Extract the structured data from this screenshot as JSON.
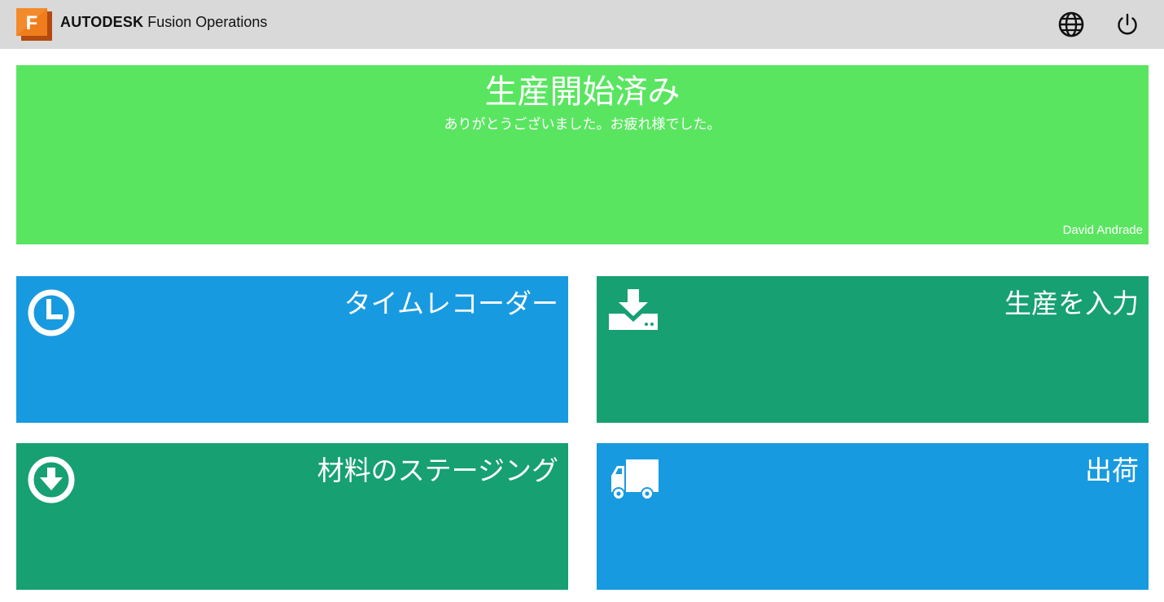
{
  "header": {
    "brand_bold": "AUTODESK",
    "brand_product": "Fusion Operations",
    "logo_letter": "F",
    "logo_color": "#f07d1c",
    "language_icon": "globe-icon",
    "logout_icon": "power-icon"
  },
  "status": {
    "title": "生産開始済み",
    "message": "ありがとうございました。お疲れ様でした。",
    "user": "David Andrade",
    "color": "#5ae561"
  },
  "tiles": [
    {
      "label": "タイムレコーダー",
      "icon": "clock-icon",
      "color": "#189ae0"
    },
    {
      "label": "生産を入力",
      "icon": "download-tray-icon",
      "color": "#17a071"
    },
    {
      "label": "材料のステージング",
      "icon": "download-circle-icon",
      "color": "#17a071"
    },
    {
      "label": "出荷",
      "icon": "truck-icon",
      "color": "#189ae0"
    }
  ]
}
